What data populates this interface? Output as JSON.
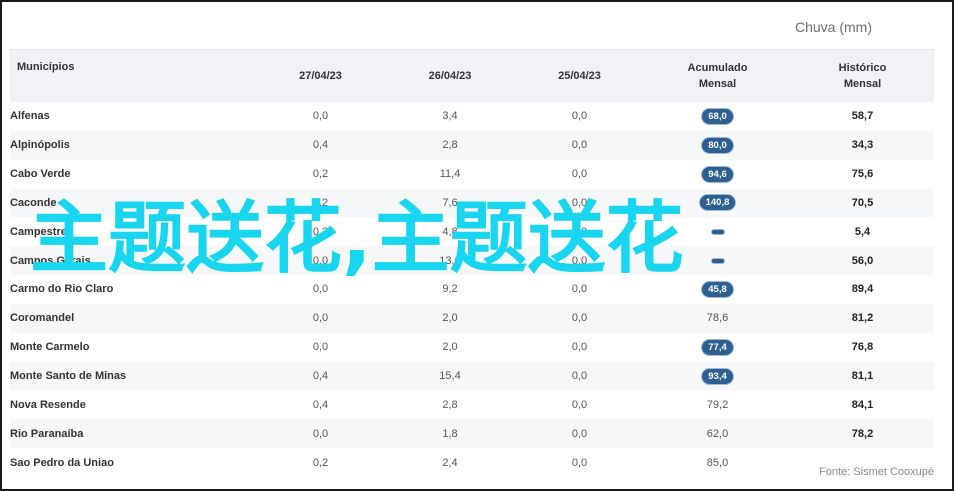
{
  "caption": "Chuva (mm)",
  "source": "Fonte: Sismet Cooxupé",
  "watermark": "主题送花,主题送花",
  "headers": [
    "Municípios",
    "27/04/23",
    "26/04/23",
    "25/04/23",
    "Acumulado Mensal",
    "Histórico Mensal"
  ],
  "highlight_color": "#2e5f92",
  "rows": [
    {
      "municipio": "Alfenas",
      "d27": "0,0",
      "d26": "3,4",
      "d25": "0,0",
      "acumulado": "68,0",
      "highlight": true,
      "historico": "58,7"
    },
    {
      "municipio": "Alpinópolis",
      "d27": "0,4",
      "d26": "2,8",
      "d25": "0,0",
      "acumulado": "80,0",
      "highlight": true,
      "historico": "34,3"
    },
    {
      "municipio": "Cabo Verde",
      "d27": "0,2",
      "d26": "11,4",
      "d25": "0,0",
      "acumulado": "94,6",
      "highlight": true,
      "historico": "75,6"
    },
    {
      "municipio": "Caconde",
      "d27": "0,2",
      "d26": "7,6",
      "d25": "0,0",
      "acumulado": "140,8",
      "highlight": true,
      "historico": "70,5"
    },
    {
      "municipio": "Campestre",
      "d27": "0,2",
      "d26": "4,8",
      "d25": "0,0",
      "acumulado": "",
      "highlight": true,
      "historico": "5,4"
    },
    {
      "municipio": "Campos Gerais",
      "d27": "0,0",
      "d26": "13,0",
      "d25": "0,0",
      "acumulado": "",
      "highlight": true,
      "historico": "56,0"
    },
    {
      "municipio": "Carmo do Rio Claro",
      "d27": "0,0",
      "d26": "9,2",
      "d25": "0,0",
      "acumulado": "45,8",
      "highlight": true,
      "historico": "89,4"
    },
    {
      "municipio": "Coromandel",
      "d27": "0,0",
      "d26": "2,0",
      "d25": "0,0",
      "acumulado": "78,6",
      "highlight": false,
      "historico": "81,2"
    },
    {
      "municipio": "Monte Carmelo",
      "d27": "0,0",
      "d26": "2,0",
      "d25": "0,0",
      "acumulado": "77,4",
      "highlight": true,
      "historico": "76,8"
    },
    {
      "municipio": "Monte Santo de Minas",
      "d27": "0,4",
      "d26": "15,4",
      "d25": "0,0",
      "acumulado": "93,4",
      "highlight": true,
      "historico": "81,1"
    },
    {
      "municipio": "Nova Resende",
      "d27": "0,4",
      "d26": "2,8",
      "d25": "0,0",
      "acumulado": "79,2",
      "highlight": false,
      "historico": "84,1"
    },
    {
      "municipio": "Rio Paranaíba",
      "d27": "0,0",
      "d26": "1,8",
      "d25": "0,0",
      "acumulado": "62,0",
      "highlight": false,
      "historico": "78,2"
    },
    {
      "municipio": "Sao Pedro da Uniao",
      "d27": "0,2",
      "d26": "2,4",
      "d25": "0,0",
      "acumulado": "85,0",
      "highlight": false,
      "historico": ""
    }
  ]
}
